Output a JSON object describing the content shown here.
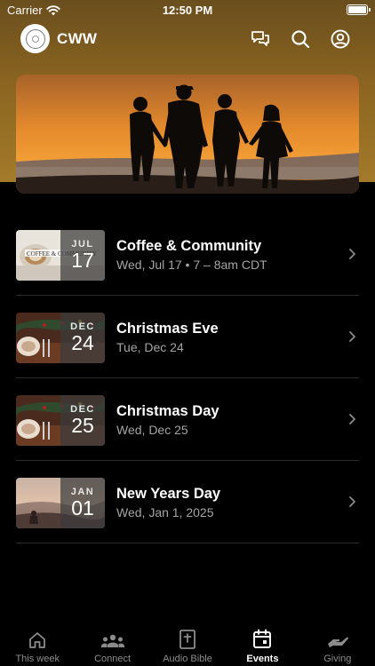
{
  "status_bar": {
    "carrier": "Carrier",
    "time": "12:50 PM",
    "battery_level": 1.0
  },
  "app": {
    "name": "CWW"
  },
  "header_icons": [
    "chat-icon",
    "search-icon",
    "profile-icon"
  ],
  "events": [
    {
      "month": "JUL",
      "day": "17",
      "title": "Coffee & Community",
      "subtitle": "Wed, Jul 17 • 7 – 8am CDT",
      "thumb": "coffee"
    },
    {
      "month": "DEC",
      "day": "24",
      "title": "Christmas Eve",
      "subtitle": "Tue, Dec 24",
      "thumb": "christmas"
    },
    {
      "month": "DEC",
      "day": "25",
      "title": "Christmas Day",
      "subtitle": "Wed, Dec 25",
      "thumb": "christmas"
    },
    {
      "month": "JAN",
      "day": "01",
      "title": "New Years Day",
      "subtitle": "Wed, Jan 1, 2025",
      "thumb": "sunset"
    }
  ],
  "tabs": [
    {
      "label": "This week",
      "icon": "home-icon",
      "active": false
    },
    {
      "label": "Connect",
      "icon": "people-icon",
      "active": false
    },
    {
      "label": "Audio Bible",
      "icon": "bible-icon",
      "active": false
    },
    {
      "label": "Events",
      "icon": "calendar-icon",
      "active": true
    },
    {
      "label": "Giving",
      "icon": "giving-icon",
      "active": false
    }
  ],
  "colors": {
    "header": "#8a6420",
    "background": "#000000",
    "inactive_tab": "#8c8c8c",
    "subtitle": "#a4a4a4"
  }
}
